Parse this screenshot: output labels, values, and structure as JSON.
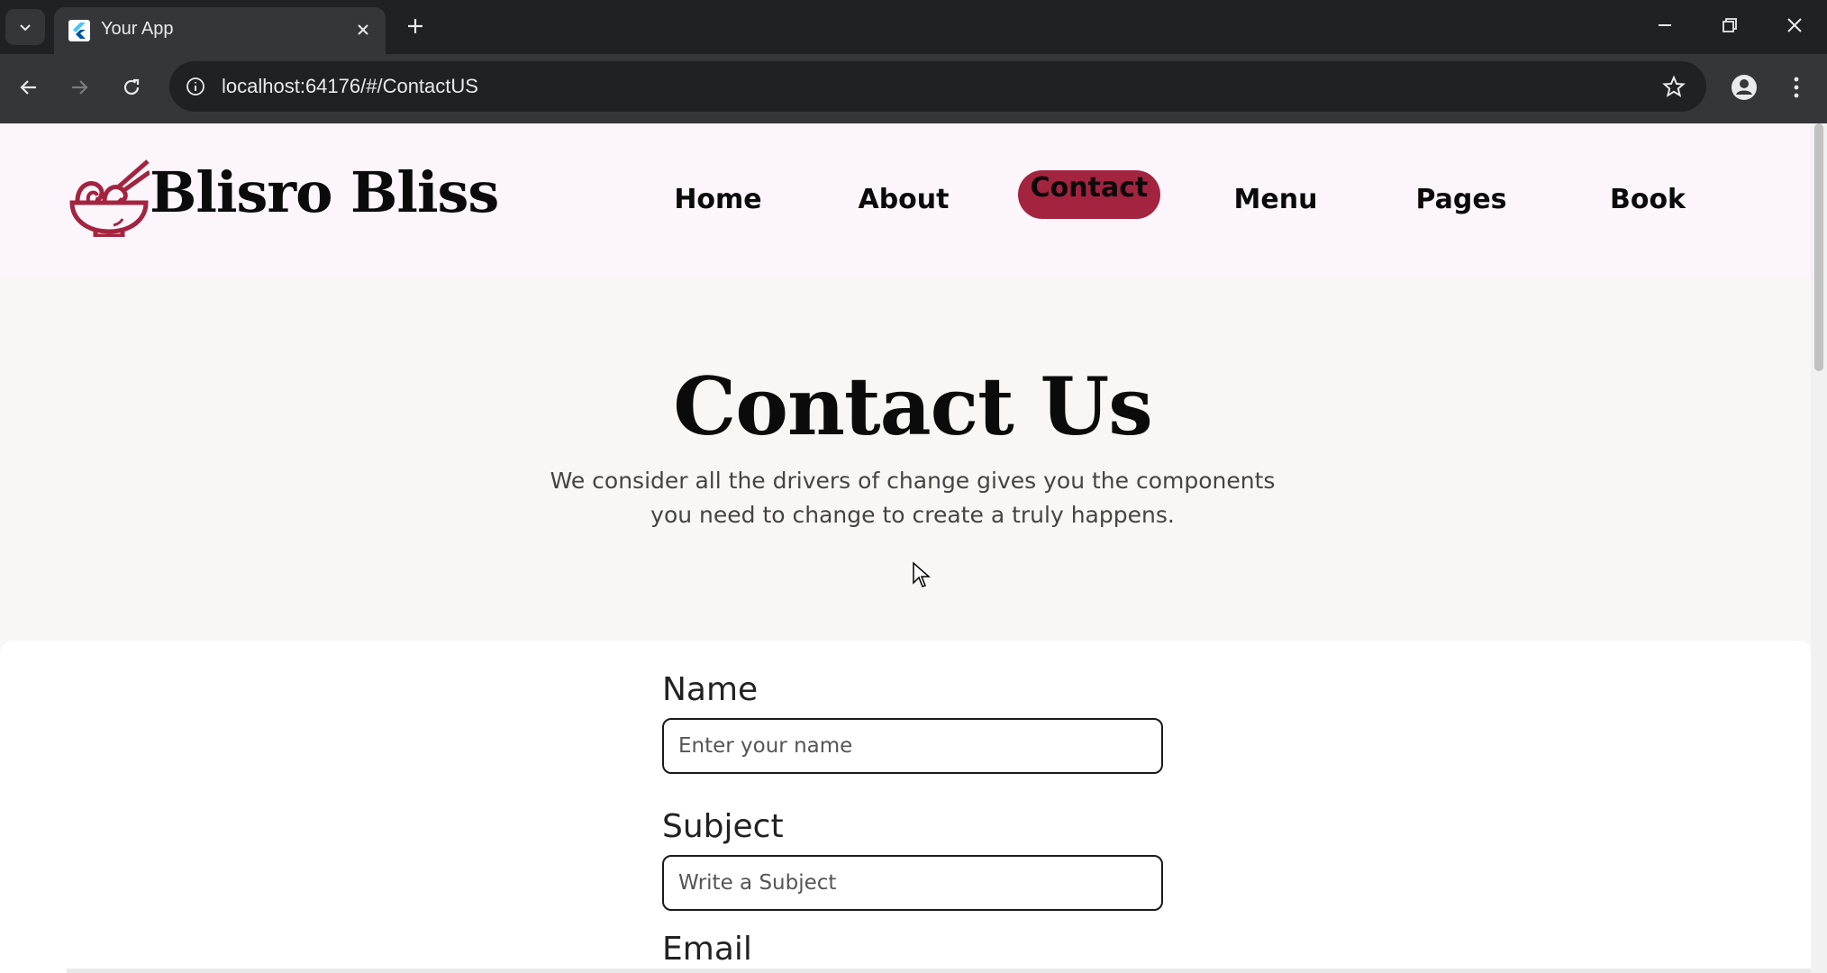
{
  "browser": {
    "tab": {
      "title": "Your App"
    },
    "address_bar": {
      "url": "localhost:64176/#/ContactUS"
    }
  },
  "site": {
    "brand": "Blisro Bliss",
    "nav": [
      {
        "label": "Home"
      },
      {
        "label": "About"
      },
      {
        "label": "Contact",
        "active": true
      },
      {
        "label": "Menu"
      },
      {
        "label": "Pages"
      },
      {
        "label": "Book"
      }
    ],
    "accent_color": "#a3243f",
    "header_bg": "#fcf5fb"
  },
  "hero": {
    "title": "Contact Us",
    "subtitle_line1": "We consider all the drivers of change gives you the components",
    "subtitle_line2": "you need to change to create a truly happens."
  },
  "form": {
    "name": {
      "label": "Name",
      "placeholder": "Enter your name"
    },
    "subject": {
      "label": "Subject",
      "placeholder": "Write a Subject"
    },
    "email": {
      "label": "Email"
    }
  },
  "icons": {
    "tab_list": "chevron-down-icon",
    "favicon": "flutter-icon",
    "tab_close": "close-icon",
    "new_tab": "plus-icon",
    "back": "arrow-left-icon",
    "forward": "arrow-right-icon",
    "reload": "reload-icon",
    "site_info": "info-icon",
    "bookmark": "star-icon",
    "profile": "profile-icon",
    "menu": "kebab-menu-icon",
    "logo": "noodle-bowl-icon"
  }
}
